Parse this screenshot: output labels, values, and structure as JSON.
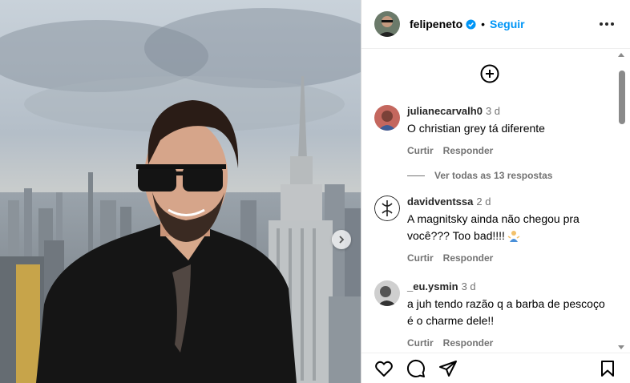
{
  "header": {
    "username": "felipeneto",
    "separator": "•",
    "follow_label": "Seguir"
  },
  "comments": [
    {
      "username": "julianecarvalh0",
      "time": "3 d",
      "text": "O christian grey tá diferente",
      "reply_label": "Curtir",
      "answer_label": "Responder"
    },
    {
      "username": "davidventssa",
      "time": "2 d",
      "text": "A magnitsky ainda não chegou pra você??? Too bad!!!!",
      "emoji": "person-shrugging-emoji",
      "reply_label": "Curtir",
      "answer_label": "Responder"
    },
    {
      "username": "_eu.ysmin",
      "time": "3 d",
      "text": "a juh tendo razão q a barba de pescoço é o charme dele!!",
      "reply_label": "Curtir",
      "answer_label": "Responder"
    }
  ],
  "replies_link": "Ver todas as 13 respostas",
  "icons": [
    "add-circle-icon",
    "heart-icon",
    "comment-icon",
    "share-icon",
    "bookmark-icon",
    "more-options-icon",
    "verified-icon",
    "next-arrow-icon"
  ],
  "colors": {
    "accent": "#0095f6",
    "muted": "#737373",
    "verified": "#0095f6"
  }
}
